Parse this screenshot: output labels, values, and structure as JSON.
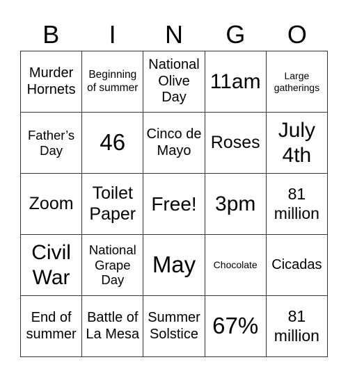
{
  "card": {
    "header": [
      "B",
      "I",
      "N",
      "G",
      "O"
    ],
    "rows": [
      [
        "Murder Hornets",
        "Beginning of summer",
        "National Olive Day",
        "11am",
        "Large gatherings"
      ],
      [
        "Father’s Day",
        "46",
        "Cinco de Mayo",
        "Roses",
        "July 4th"
      ],
      [
        "Zoom",
        "Toilet Paper",
        "Free!",
        "3pm",
        "81 million"
      ],
      [
        "Civil War",
        "National Grape Day",
        "May",
        "Chocolate",
        "Cicadas"
      ],
      [
        "End of summer",
        "Battle of La Mesa",
        "Summer Solstice",
        "67%",
        "81 million"
      ]
    ]
  },
  "colors": {
    "grid_line": "#333333",
    "text": "#000000",
    "background": "#ffffff"
  }
}
